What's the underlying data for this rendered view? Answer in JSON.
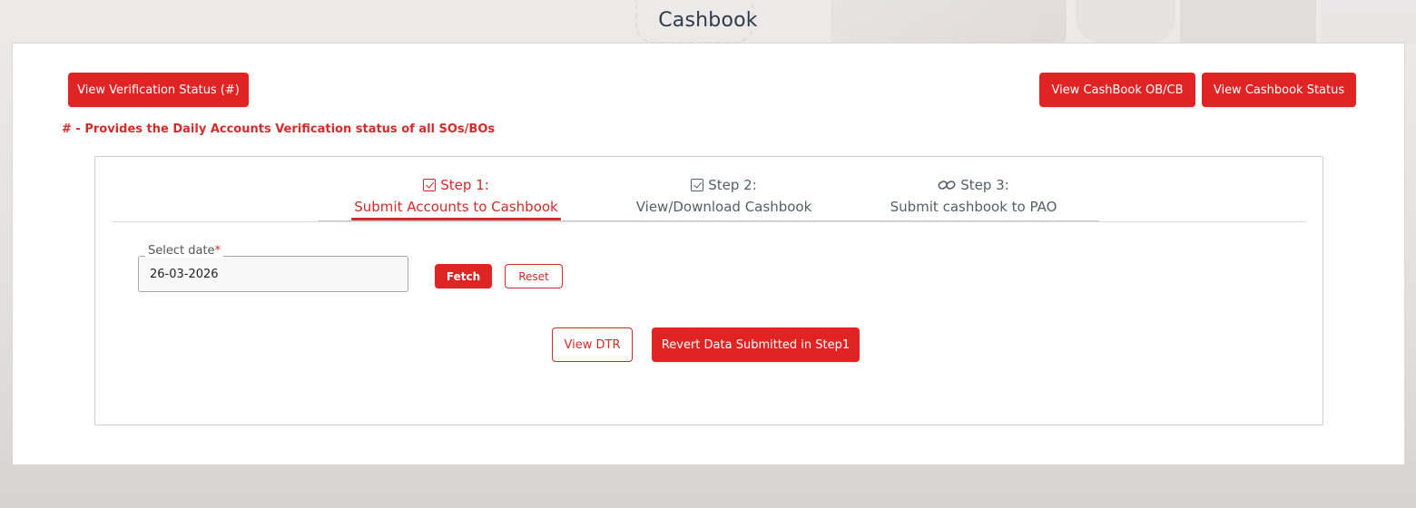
{
  "page": {
    "title": "Cashbook"
  },
  "top_actions": {
    "verification_status": "View Verification Status (#)",
    "cashbook_obcb": "View CashBook OB/CB",
    "cashbook_status": "View Cashbook Status"
  },
  "note": "# - Provides the Daily Accounts Verification status of all SOs/BOs",
  "steps": [
    {
      "title": "Step 1:",
      "subtitle": "Submit Accounts to Cashbook",
      "icon": "checkbox-icon",
      "active": true
    },
    {
      "title": "Step 2:",
      "subtitle": "View/Download Cashbook",
      "icon": "checkbox-icon",
      "active": false
    },
    {
      "title": "Step 3:",
      "subtitle": "Submit cashbook to PAO",
      "icon": "link-icon",
      "active": false
    }
  ],
  "form": {
    "date_label": "Select date",
    "required_marker": "*",
    "date_value": "26-03-2026",
    "fetch_label": "Fetch",
    "reset_label": "Reset"
  },
  "actions": {
    "view_dtr": "View DTR",
    "revert": "Revert Data Submitted in Step1"
  },
  "colors": {
    "primary": "#e02424",
    "accent_text": "#d32a2a",
    "title_text": "#2f3a4b"
  }
}
